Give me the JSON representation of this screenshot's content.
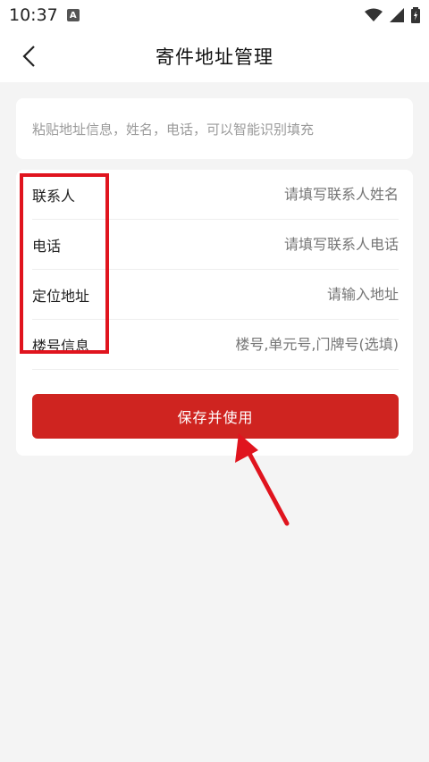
{
  "status_bar": {
    "time": "10:37",
    "notification_letter": "A"
  },
  "header": {
    "title": "寄件地址管理"
  },
  "paste_box": {
    "placeholder": "粘贴地址信息，姓名，电话，可以智能识别填充"
  },
  "form": {
    "rows": [
      {
        "label": "联系人",
        "placeholder": "请填写联系人姓名"
      },
      {
        "label": "电话",
        "placeholder": "请填写联系人电话"
      },
      {
        "label": "定位地址",
        "placeholder": "请输入地址"
      },
      {
        "label": "楼号信息",
        "placeholder": "楼号,单元号,门牌号(选填)"
      }
    ]
  },
  "save_button": {
    "label": "保存并使用"
  },
  "annotations": {
    "highlight_color": "#e0141e"
  },
  "colors": {
    "primary": "#cf2420",
    "background": "#f4f4f4"
  }
}
